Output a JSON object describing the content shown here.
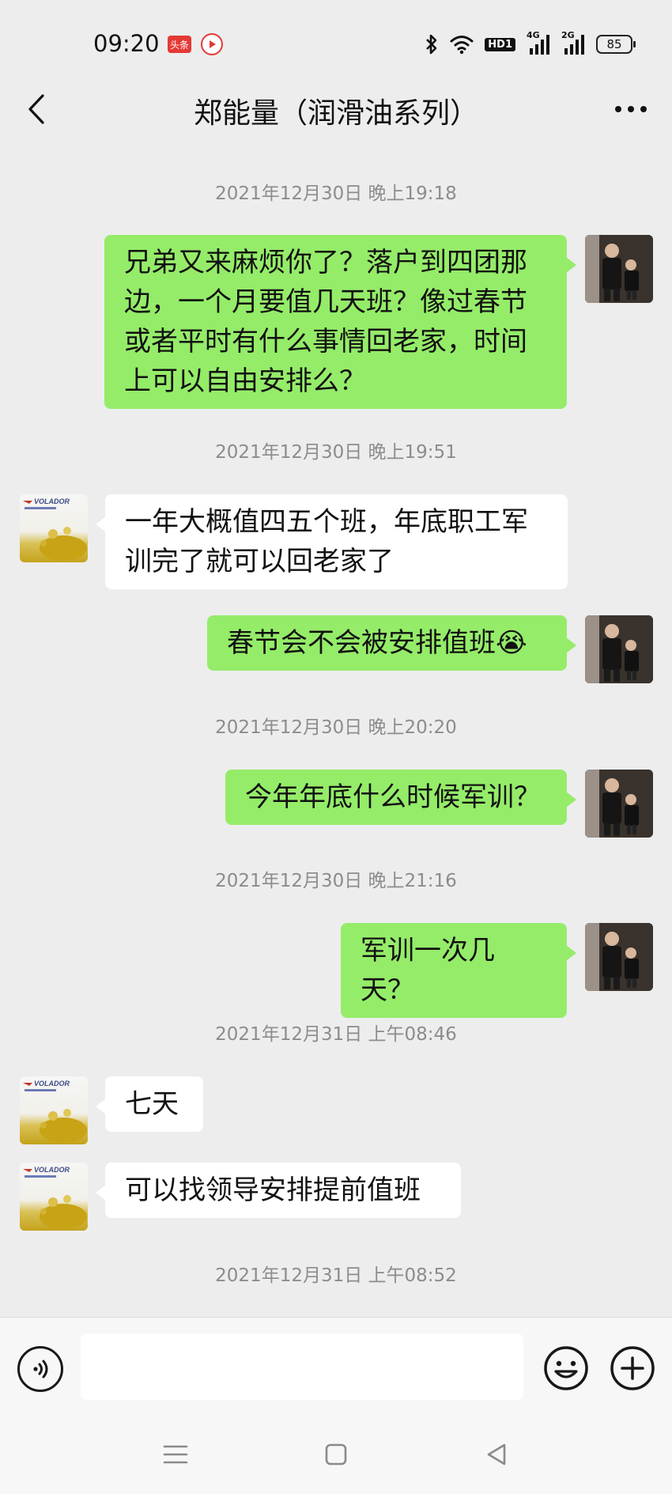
{
  "status_bar": {
    "time": "09:20",
    "toutiao_badge": "头条",
    "network_1": "4G",
    "network_2": "2G",
    "hd_label": "HD1",
    "battery": "85",
    "icons": [
      "bluetooth-icon",
      "wifi-icon",
      "signal-icon",
      "battery-icon"
    ]
  },
  "header": {
    "title": "郑能量（润滑油系列）",
    "back_icon": "chevron-left-icon",
    "more_icon": "more-dots-icon"
  },
  "messages": [
    {
      "type": "timestamp",
      "text": "2021年12月30日 晚上19:18"
    },
    {
      "type": "message",
      "direction": "out",
      "text": "兄弟又来麻烦你了？落户到四团那边，一个月要值几天班？像过春节或者平时有什么事情回老家，时间上可以自由安排么？"
    },
    {
      "type": "timestamp",
      "text": "2021年12月30日 晚上19:51"
    },
    {
      "type": "message",
      "direction": "in",
      "text": "一年大概值四五个班，年底职工军训完了就可以回老家了"
    },
    {
      "type": "message",
      "direction": "out",
      "text": "春节会不会被安排值班",
      "emoji": "😭"
    },
    {
      "type": "timestamp",
      "text": "2021年12月30日 晚上20:20"
    },
    {
      "type": "message",
      "direction": "out",
      "text": "今年年底什么时候军训？"
    },
    {
      "type": "timestamp",
      "text": "2021年12月30日 晚上21:16"
    },
    {
      "type": "message",
      "direction": "out",
      "text": "军训一次几天？"
    },
    {
      "type": "timestamp",
      "text": "2021年12月31日 上午08:46"
    },
    {
      "type": "message",
      "direction": "in",
      "text": "七天"
    },
    {
      "type": "message",
      "direction": "in",
      "text": "可以找领导安排提前值班"
    },
    {
      "type": "timestamp",
      "text": "2021年12月31日 上午08:52"
    }
  ],
  "contact_avatar_label": "VOLADOR",
  "input_bar": {
    "value": "",
    "placeholder": "",
    "voice_icon": "voice-icon",
    "emoji_icon": "emoji-icon",
    "plus_icon": "plus-icon"
  },
  "system_nav": {
    "buttons": [
      "menu-icon",
      "home-icon",
      "back-triangle-icon"
    ]
  },
  "colors": {
    "background": "#ededed",
    "outgoing_bubble": "#95ec69",
    "incoming_bubble": "#ffffff",
    "timestamp_text": "#8c8c8c"
  }
}
